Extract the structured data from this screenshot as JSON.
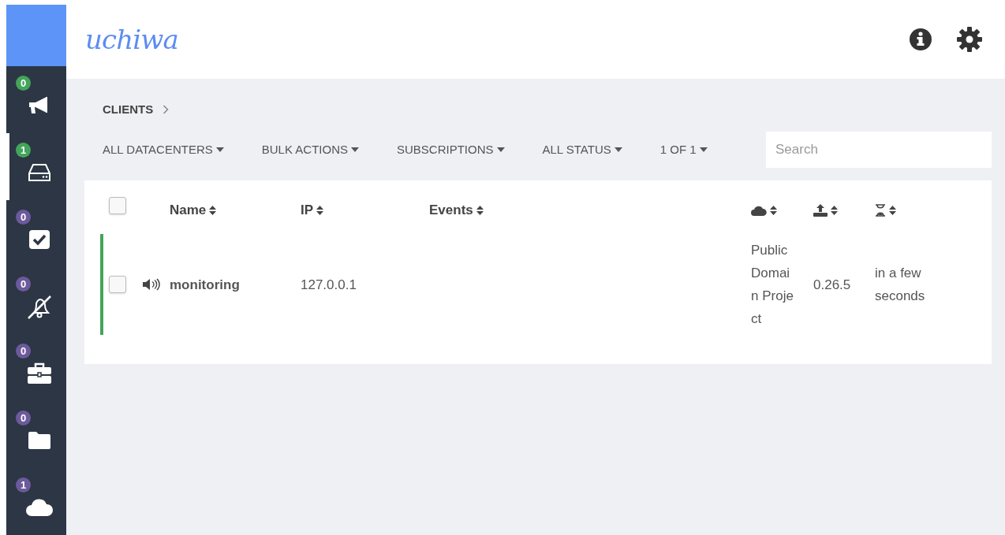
{
  "logo": "uchiwa",
  "sidebar": {
    "items": [
      {
        "count": "0",
        "color": "#43a55a",
        "selected": false
      },
      {
        "count": "1",
        "color": "#43a55a",
        "selected": true
      },
      {
        "count": "0",
        "color": "#6c5a9c",
        "selected": false
      },
      {
        "count": "0",
        "color": "#6c5a9c",
        "selected": false
      },
      {
        "count": "0",
        "color": "#6c5a9c",
        "selected": false
      },
      {
        "count": "0",
        "color": "#6c5a9c",
        "selected": false
      },
      {
        "count": "1",
        "color": "#6c5a9c",
        "selected": false
      }
    ]
  },
  "breadcrumb": [
    "CLIENTS"
  ],
  "filters": [
    "ALL DATACENTERS",
    "BULK ACTIONS",
    "SUBSCRIPTIONS",
    "ALL STATUS",
    "1 OF 1"
  ],
  "search": {
    "placeholder": "Search"
  },
  "table": {
    "select_all": {
      "checked": false
    },
    "columns": [
      {
        "kind": "text",
        "label": "Name"
      },
      {
        "kind": "text",
        "label": "IP"
      },
      {
        "kind": "text",
        "label": "Events"
      },
      {
        "kind": "icon"
      },
      {
        "kind": "icon"
      },
      {
        "kind": "icon"
      }
    ],
    "rows": [
      {
        "checked": false,
        "color": "#43a55a",
        "silenced": false,
        "cells": [
          "monitoring",
          "127.0.0.1",
          "",
          "Public Domain Project",
          "0.26.5",
          "in a few seconds"
        ]
      }
    ]
  }
}
